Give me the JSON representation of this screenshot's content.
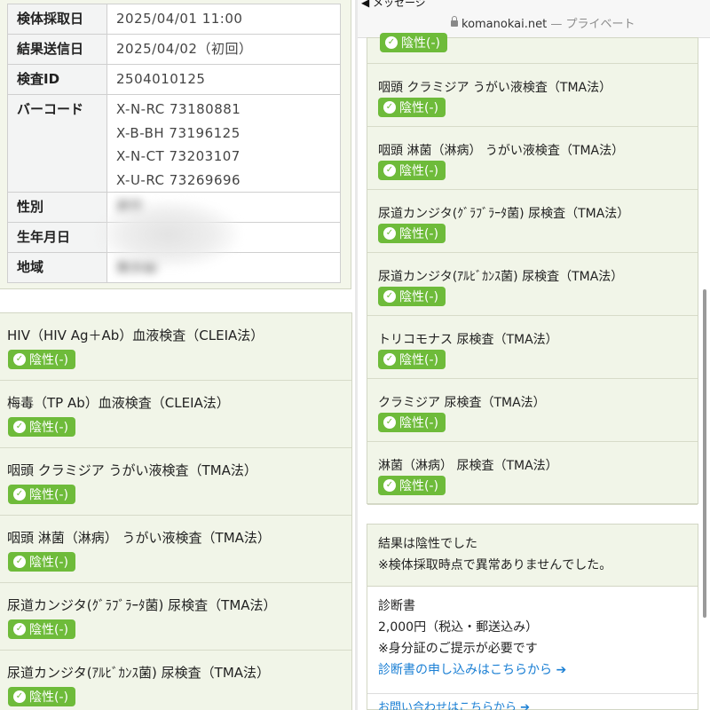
{
  "info": {
    "rows": [
      {
        "label": "検体採取日",
        "value": "2025/04/01 11:00"
      },
      {
        "label": "結果送信日",
        "value": "2025/04/02（初回）"
      },
      {
        "label": "検査ID",
        "value": "2504010125"
      },
      {
        "label": "性別",
        "value": "男性"
      },
      {
        "label": "生年月日",
        "value": ""
      },
      {
        "label": "地域",
        "value": "東京都"
      }
    ],
    "barcode_label": "バーコード",
    "barcodes": [
      "X-N-RC 73180881",
      "X-B-BH 73196125",
      "X-N-CT 73203107",
      "X-U-RC 73269696"
    ]
  },
  "negative_label": "陰性(-)",
  "left_tests": [
    "HIV（HIV Ag＋Ab）血液検査（CLEIA法）",
    "梅毒（TP Ab）血液検査（CLEIA法）",
    "咽頭 クラミジア うがい液検査（TMA法）",
    "咽頭 淋菌（淋病） うがい液検査（TMA法）",
    "尿道カンジタ(ｸﾞﾗﾌﾞﾗｰﾀ菌) 尿検査（TMA法）",
    "尿道カンジタ(ｱﾙﾋﾞｶﾝｽ菌) 尿検査（TMA法）"
  ],
  "right_tests": [
    "咽頭 クラミジア うがい液検査（TMA法）",
    "咽頭 淋菌（淋病） うがい液検査（TMA法）",
    "尿道カンジタ(ｸﾞﾗﾌﾞﾗｰﾀ菌) 尿検査（TMA法）",
    "尿道カンジタ(ｱﾙﾋﾞｶﾝｽ菌) 尿検査（TMA法）",
    "トリコモナス 尿検査（TMA法）",
    "クラミジア 尿検査（TMA法）",
    "淋菌（淋病） 尿検査（TMA法）"
  ],
  "browser": {
    "back_label": "◀ メッセージ",
    "domain": "komanokai.net",
    "mode": "— プライベート"
  },
  "summary": {
    "line1": "結果は陰性でした",
    "line2": "※検体採取時点で異常ありませんでした。",
    "cert_title": "診断書",
    "cert_price": "2,000円（税込・郵送込み）",
    "cert_note": "※身分証のご提示が必要です",
    "cert_link": "診断書の申し込みはこちらから",
    "contact_link": "お問い合わせはこちらから"
  }
}
